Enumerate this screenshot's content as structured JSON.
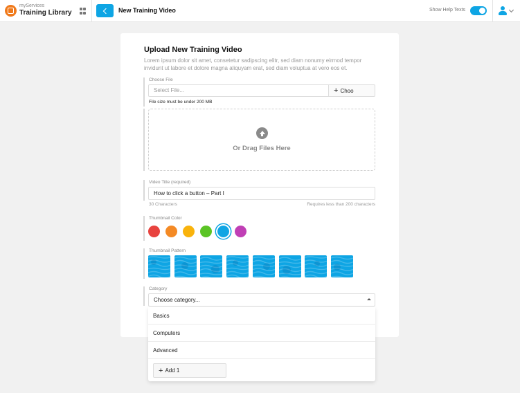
{
  "header": {
    "brand_subtitle": "myServices",
    "brand_title": "Training Library",
    "page_title": "New Training Video",
    "help_toggle_label": "Show Help Texts",
    "help_toggle_on": true,
    "accent_color": "#0ea5e4"
  },
  "form": {
    "title": "Upload New Training Video",
    "description": "Lorem ipsum dolor sit amet, consetetur sadipscing elitr, sed diam nonumy eirmod tempor invidunt ut labore et dolore magna aliquyam erat, sed diam voluptua at vero eos et.",
    "file": {
      "label": "Choose File",
      "placeholder": "Select File...",
      "choose_label": "Choo",
      "hint": "File size must be under 200 MB",
      "drop_text": "Or Drag Files Here"
    },
    "video_title": {
      "label": "Video Title (required)",
      "value": "How to click a button – Part I",
      "char_count": "30 Characters",
      "requirement": "Requires less than 200 characters"
    },
    "thumbnail_color": {
      "label": "Thumbnail Color",
      "colors": [
        "#e8433f",
        "#f48a25",
        "#f9b30c",
        "#5bc425",
        "#0ea5e4",
        "#c03fb5"
      ],
      "selected_index": 4
    },
    "thumbnail_pattern": {
      "label": "Thumbnail Pattern",
      "pattern_count": 8
    },
    "category": {
      "label": "Category",
      "placeholder": "Choose category...",
      "options": [
        "Basics",
        "Computers",
        "Advanced"
      ],
      "add_label": "Add 1"
    }
  }
}
